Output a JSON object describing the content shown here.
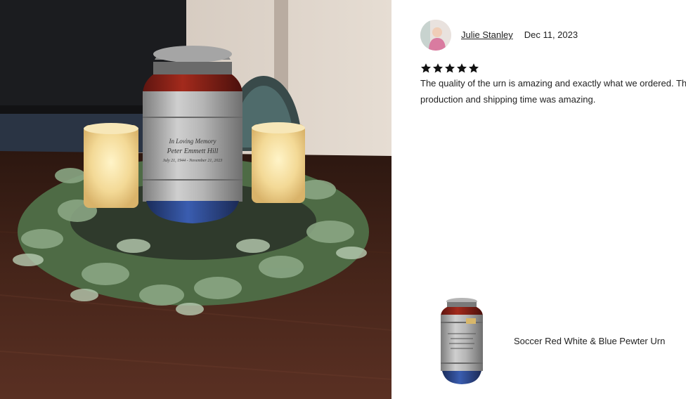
{
  "photo": {
    "engraving_line1": "In Loving Memory",
    "engraving_line2": "Peter Emmett Hill",
    "engraving_line3": "July 21, 1944 - November 21, 2023"
  },
  "review": {
    "reviewer_name": "Julie Stanley",
    "date": "Dec 11, 2023",
    "rating": 5,
    "text_line1": "The quality of the urn is amazing and exactly what we ordered. The",
    "text_line2": "production and shipping time was amazing."
  },
  "product": {
    "name": "Soccer Red White & Blue Pewter Urn"
  },
  "colors": {
    "star": "#111111",
    "urn_red": "#8e1f16",
    "urn_blue": "#2d4a8c",
    "pewter": "#a9a9a9",
    "table": "#3a1e14"
  }
}
